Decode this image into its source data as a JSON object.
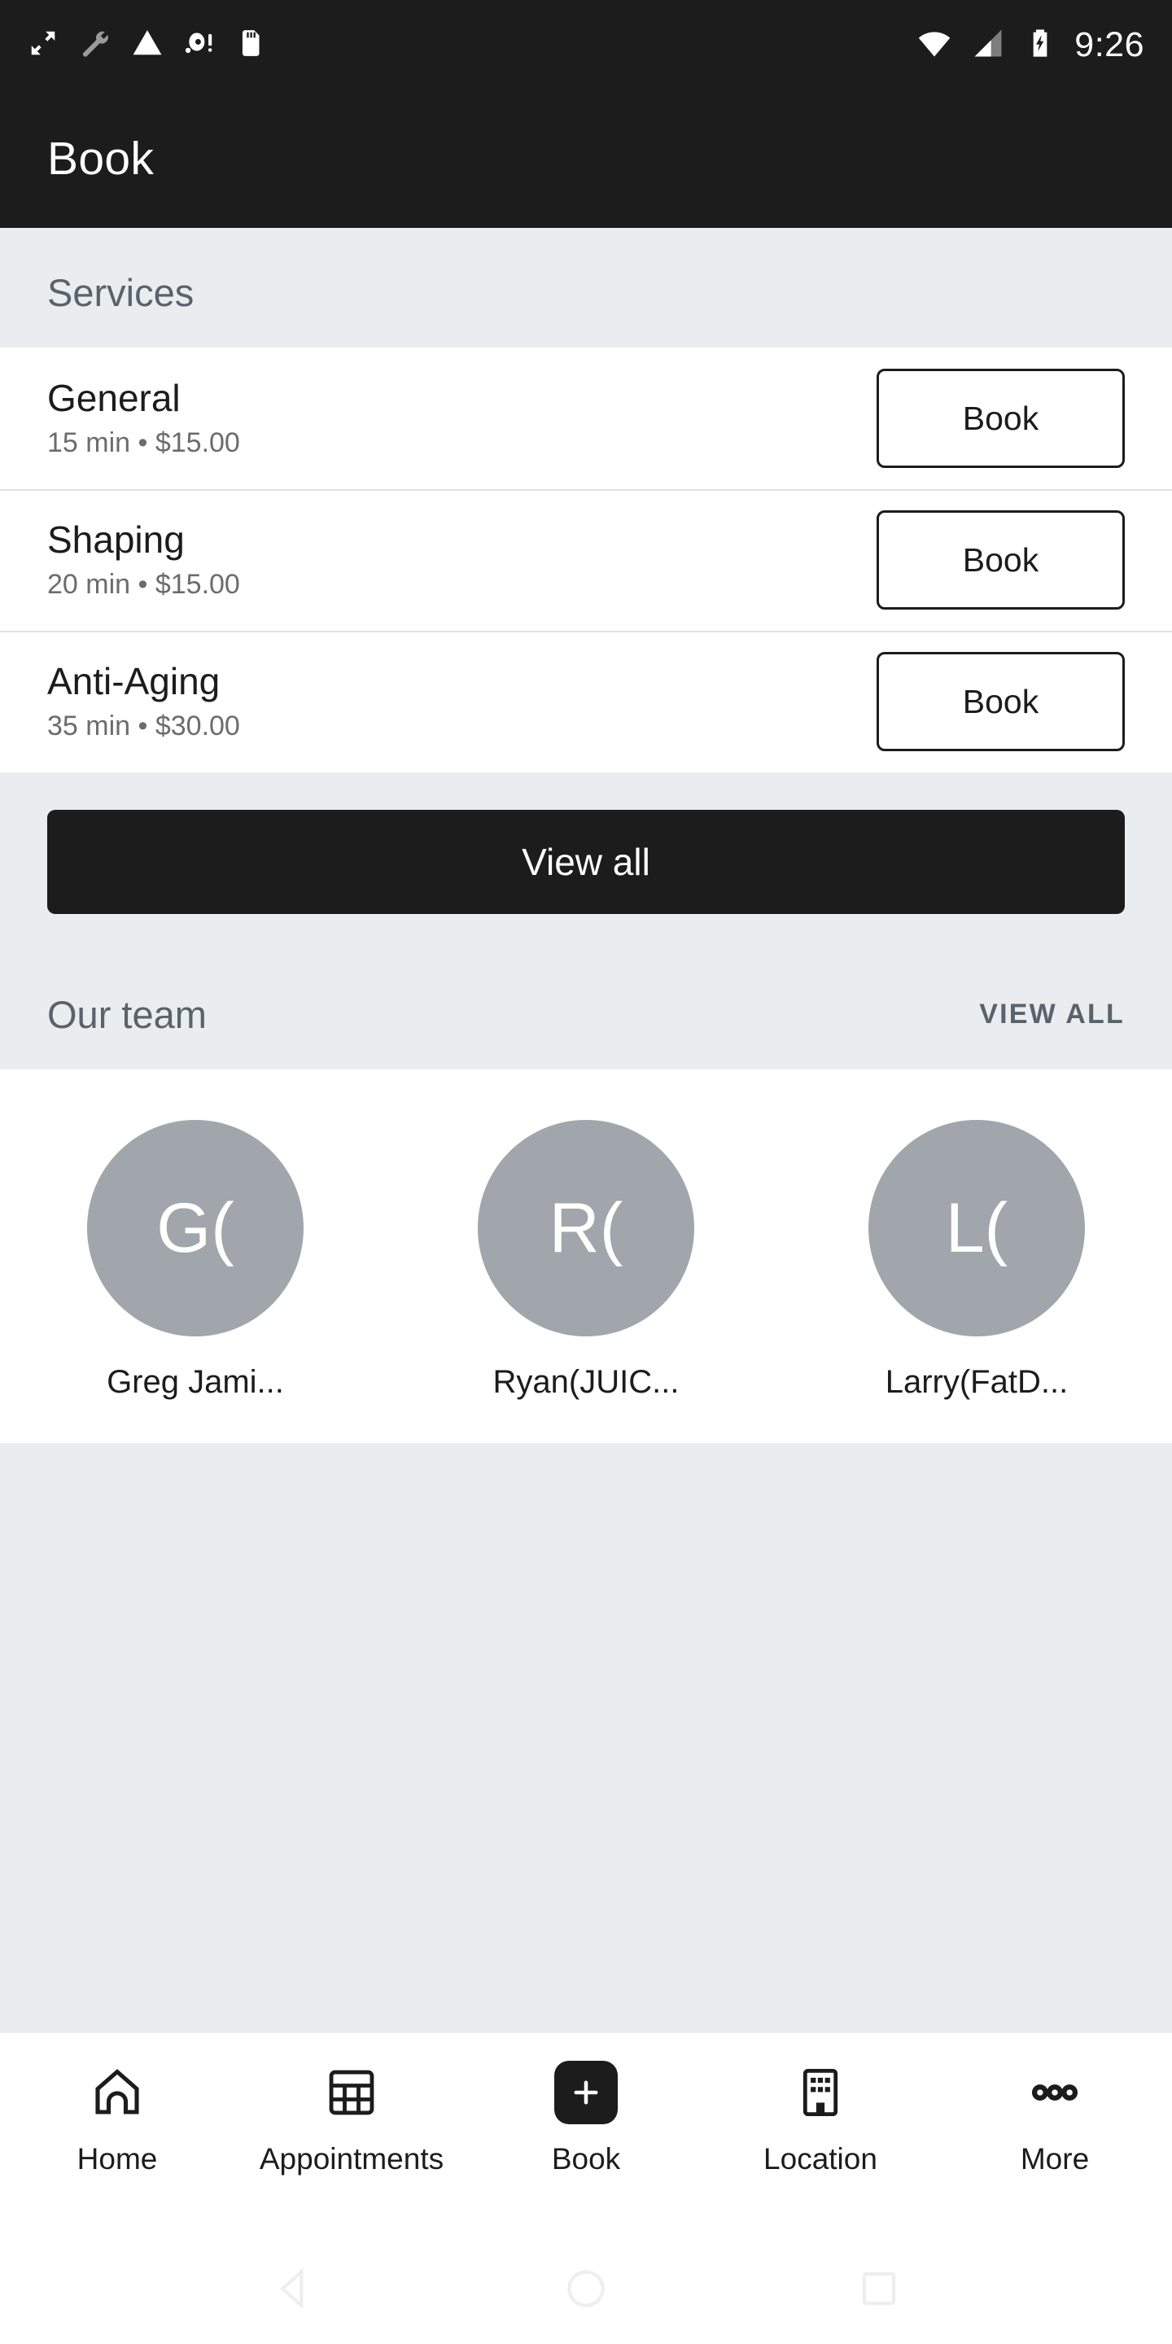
{
  "status_bar": {
    "time": "9:26",
    "left_icons": [
      "fullscreen-icon",
      "wrench-icon",
      "warning-triangle-icon",
      "adb-bug-icon",
      "sd-card-icon"
    ],
    "right_icons": [
      "wifi-icon",
      "cellular-signal-icon",
      "battery-charging-icon"
    ]
  },
  "app_bar": {
    "title": "Book"
  },
  "services_section": {
    "title": "Services",
    "items": [
      {
        "name": "General",
        "meta": "15 min • $15.00",
        "duration": "15 min",
        "price": "$15.00",
        "action": "Book"
      },
      {
        "name": "Shaping",
        "meta": "20 min • $15.00",
        "duration": "20 min",
        "price": "$15.00",
        "action": "Book"
      },
      {
        "name": "Anti-Aging",
        "meta": "35 min • $30.00",
        "duration": "35 min",
        "price": "$30.00",
        "action": "Book"
      }
    ],
    "view_all_label": "View all"
  },
  "team_section": {
    "title": "Our team",
    "view_all_label": "VIEW ALL",
    "members": [
      {
        "initials": "G(",
        "name": "Greg Jami..."
      },
      {
        "initials": "R(",
        "name": "Ryan(JUIC..."
      },
      {
        "initials": "L(",
        "name": "Larry(FatD..."
      }
    ]
  },
  "bottom_nav": {
    "items": [
      {
        "label": "Home",
        "icon": "home-icon"
      },
      {
        "label": "Appointments",
        "icon": "calendar-grid-icon"
      },
      {
        "label": "Book",
        "icon": "plus-icon"
      },
      {
        "label": "Location",
        "icon": "building-icon"
      },
      {
        "label": "More",
        "icon": "more-dots-icon"
      }
    ]
  },
  "system_nav": {
    "keys": [
      "back-key",
      "home-key",
      "recents-key"
    ]
  },
  "colors": {
    "dark": "#1c1c1c",
    "surface": "#ffffff",
    "section_bg": "#e9edef",
    "muted_text": "#5a636b",
    "avatar_bg": "#a0a6ab",
    "divider": "#dfe2e4"
  }
}
